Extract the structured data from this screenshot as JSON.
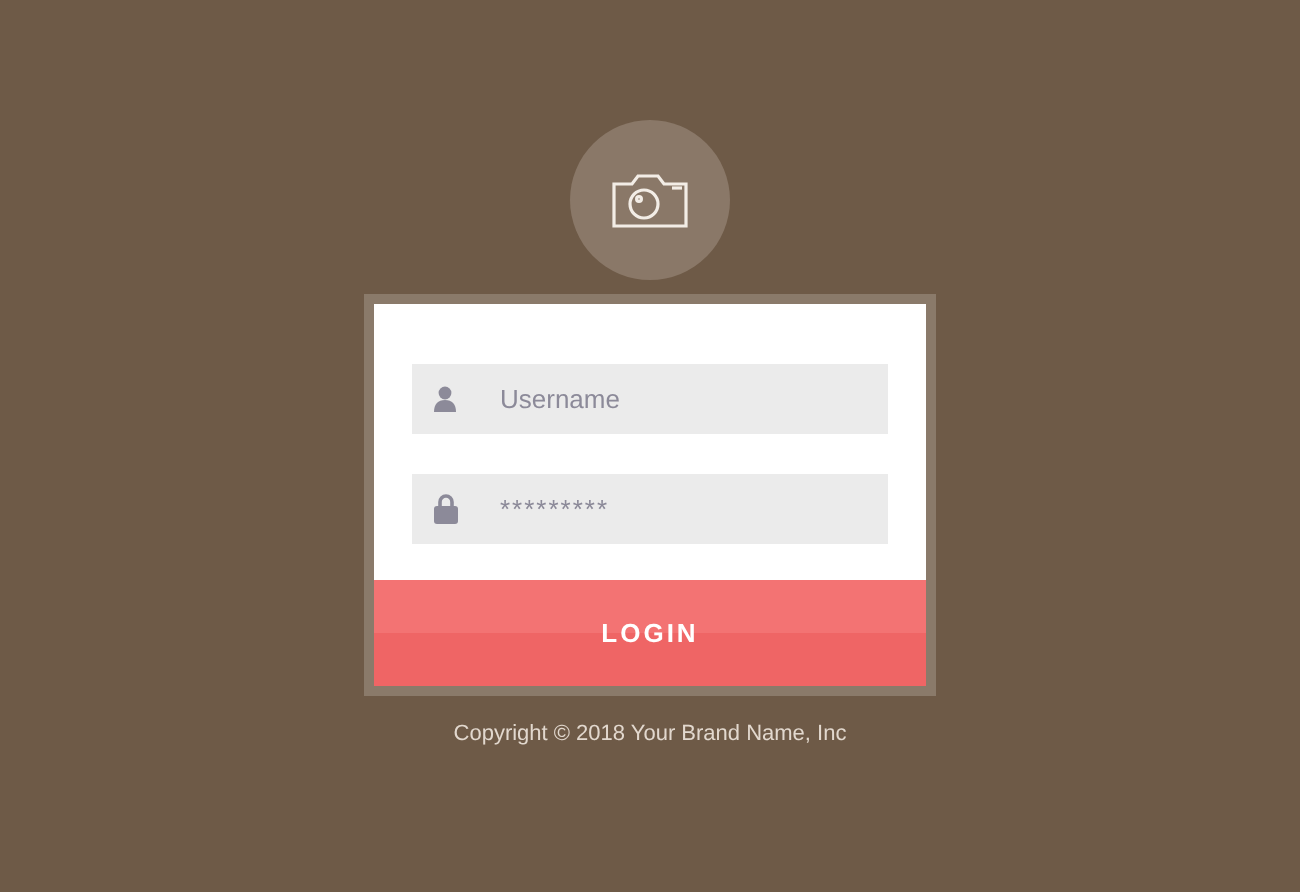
{
  "username": {
    "placeholder": "Username"
  },
  "password": {
    "placeholder": "*********"
  },
  "login_button": "LOGIN",
  "footer": "Copyright © 2018 Your Brand Name, Inc"
}
